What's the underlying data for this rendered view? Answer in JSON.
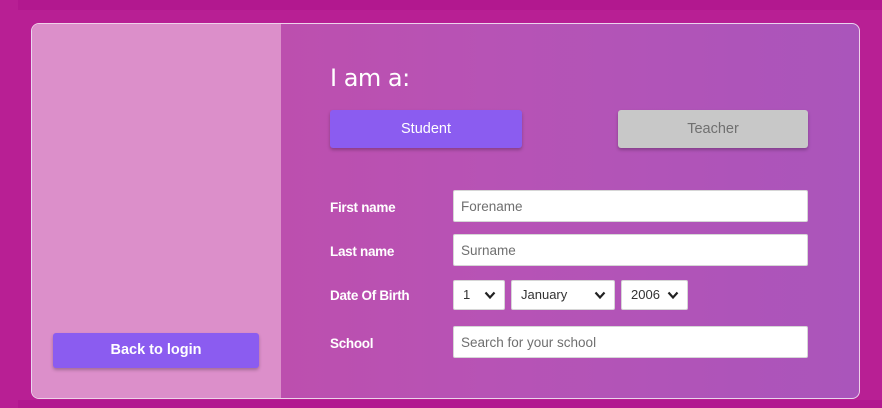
{
  "colors": {
    "background": "#b81f94",
    "left_pane": "#dc8fca",
    "accent": "#8b5cf0",
    "inactive_button": "#c8c8c8"
  },
  "left_pane": {
    "back_button_label": "Back to login"
  },
  "form": {
    "title": "I am a:",
    "roles": {
      "student_label": "Student",
      "teacher_label": "Teacher",
      "selected": "Student"
    },
    "first_name": {
      "label": "First name",
      "placeholder": "Forename",
      "value": ""
    },
    "last_name": {
      "label": "Last name",
      "placeholder": "Surname",
      "value": ""
    },
    "dob": {
      "label": "Date Of Birth",
      "day": "1",
      "month": "January",
      "year": "2006"
    },
    "school": {
      "label": "School",
      "placeholder": "Search for your school",
      "value": ""
    }
  },
  "icons": {
    "select_arrow": "chevron-down-icon"
  }
}
